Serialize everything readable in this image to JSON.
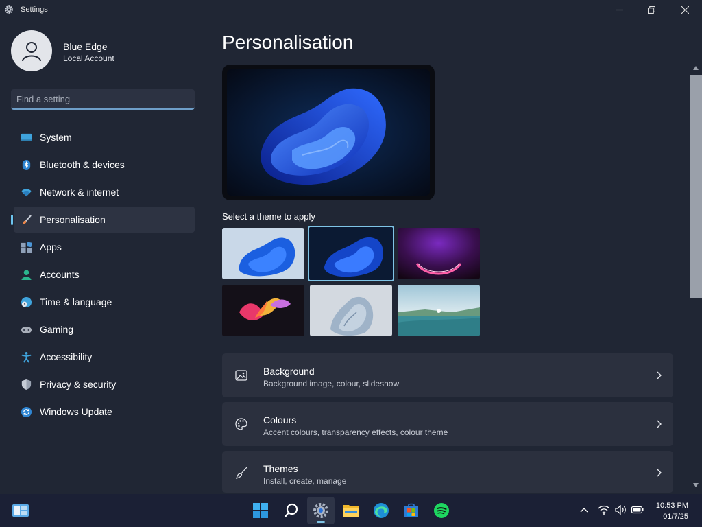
{
  "window": {
    "title": "Settings"
  },
  "user": {
    "name": "Blue Edge",
    "account_type": "Local Account"
  },
  "search": {
    "placeholder": "Find a setting"
  },
  "nav": {
    "items": [
      {
        "label": "System",
        "icon": "monitor-icon"
      },
      {
        "label": "Bluetooth & devices",
        "icon": "bluetooth-icon"
      },
      {
        "label": "Network & internet",
        "icon": "wifi-icon"
      },
      {
        "label": "Personalisation",
        "icon": "brush-icon",
        "active": true
      },
      {
        "label": "Apps",
        "icon": "apps-icon"
      },
      {
        "label": "Accounts",
        "icon": "person-icon"
      },
      {
        "label": "Time & language",
        "icon": "globe-clock-icon"
      },
      {
        "label": "Gaming",
        "icon": "gamepad-icon"
      },
      {
        "label": "Accessibility",
        "icon": "accessibility-icon"
      },
      {
        "label": "Privacy & security",
        "icon": "shield-icon"
      },
      {
        "label": "Windows Update",
        "icon": "update-icon"
      }
    ]
  },
  "main": {
    "title": "Personalisation",
    "select_theme_label": "Select a theme to apply",
    "themes": [
      {
        "name": "windows-light-bloom"
      },
      {
        "name": "windows-dark-bloom",
        "selected": true
      },
      {
        "name": "glow"
      },
      {
        "name": "captured-motion"
      },
      {
        "name": "sunrise-bloom"
      },
      {
        "name": "flow-lake"
      }
    ],
    "cards": [
      {
        "title": "Background",
        "subtitle": "Background image, colour, slideshow",
        "icon": "image-icon"
      },
      {
        "title": "Colours",
        "subtitle": "Accent colours, transparency effects, colour theme",
        "icon": "palette-icon"
      },
      {
        "title": "Themes",
        "subtitle": "Install, create, manage",
        "icon": "brush-icon"
      }
    ]
  },
  "taskbar": {
    "apps": [
      "widgets-icon",
      "start-icon",
      "search-icon",
      "settings-icon",
      "file-explorer-icon",
      "edge-icon",
      "store-icon",
      "spotify-icon"
    ],
    "time": "10:53 PM",
    "date": "01/7/25"
  },
  "colors": {
    "accent": "#6cc4ee",
    "background": "#202634",
    "card": "#2b303e",
    "taskbar": "#1b2035"
  }
}
